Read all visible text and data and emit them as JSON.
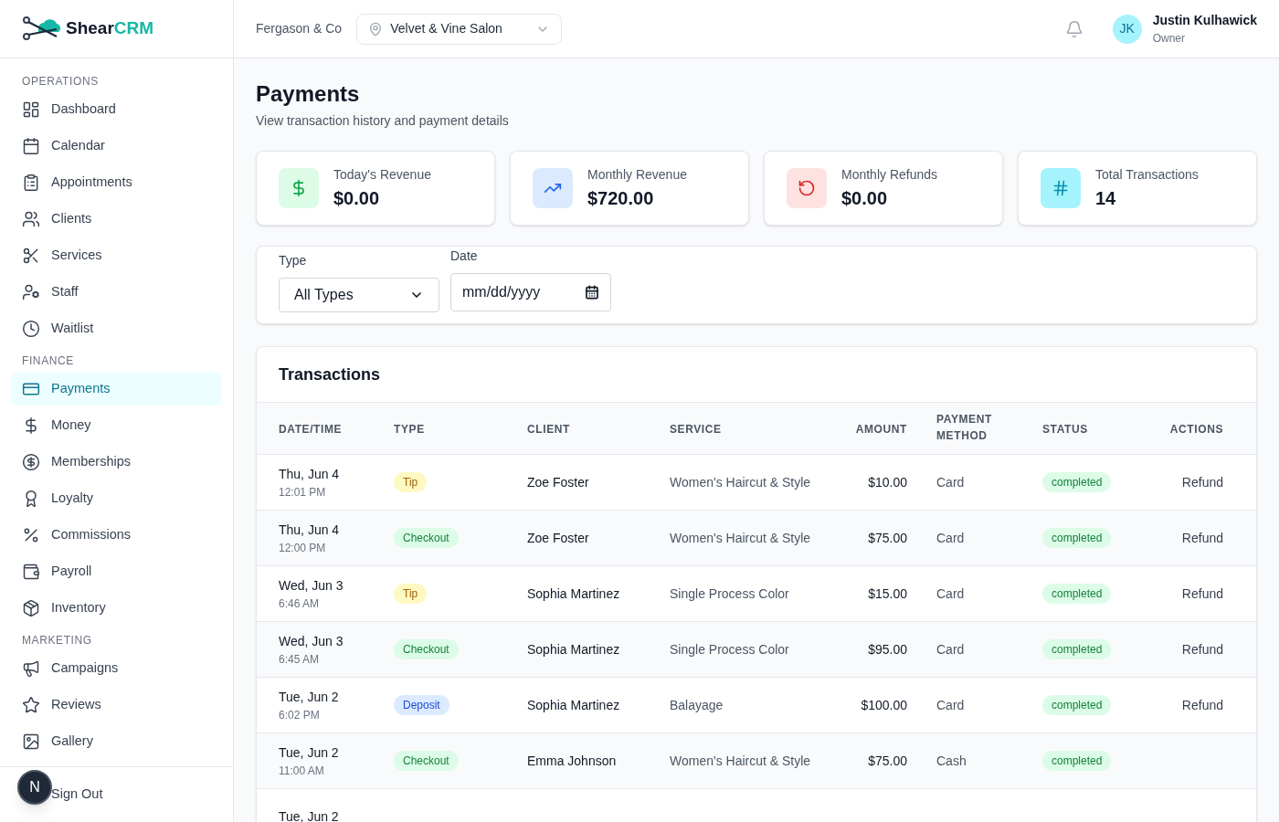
{
  "brand": {
    "first": "Shear",
    "second": "CRM"
  },
  "sidebar": {
    "sections": [
      {
        "label": "OPERATIONS",
        "items": [
          {
            "label": "Dashboard",
            "selected": false
          },
          {
            "label": "Calendar",
            "selected": false
          },
          {
            "label": "Appointments",
            "selected": false
          },
          {
            "label": "Clients",
            "selected": false
          },
          {
            "label": "Services",
            "selected": false
          },
          {
            "label": "Staff",
            "selected": false
          },
          {
            "label": "Waitlist",
            "selected": false
          }
        ]
      },
      {
        "label": "FINANCE",
        "items": [
          {
            "label": "Payments",
            "selected": true
          },
          {
            "label": "Money",
            "selected": false
          },
          {
            "label": "Memberships",
            "selected": false
          },
          {
            "label": "Loyalty",
            "selected": false
          },
          {
            "label": "Commissions",
            "selected": false
          },
          {
            "label": "Payroll",
            "selected": false
          },
          {
            "label": "Inventory",
            "selected": false
          }
        ]
      },
      {
        "label": "MARKETING",
        "items": [
          {
            "label": "Campaigns",
            "selected": false
          },
          {
            "label": "Reviews",
            "selected": false
          },
          {
            "label": "Gallery",
            "selected": false
          }
        ]
      }
    ],
    "sign_out": "Sign Out"
  },
  "dev_badge": "N",
  "header": {
    "company": "Fergason & Co",
    "location": "Velvet & Vine Salon",
    "user": {
      "initials": "JK",
      "name": "Justin Kulhawick",
      "role": "Owner"
    }
  },
  "page": {
    "title": "Payments",
    "subtitle": "View transaction history and payment details"
  },
  "stats": [
    {
      "label": "Today's Revenue",
      "value": "$0.00"
    },
    {
      "label": "Monthly Revenue",
      "value": "$720.00"
    },
    {
      "label": "Monthly Refunds",
      "value": "$0.00"
    },
    {
      "label": "Total Transactions",
      "value": "14"
    }
  ],
  "filters": {
    "type": {
      "label": "Type",
      "value": "All Types"
    },
    "date": {
      "label": "Date",
      "placeholder": "mm/dd/yyyy"
    }
  },
  "transactions": {
    "title": "Transactions",
    "columns": [
      "DATE/TIME",
      "TYPE",
      "CLIENT",
      "SERVICE",
      "AMOUNT",
      "PAYMENT METHOD",
      "STATUS",
      "ACTIONS"
    ],
    "rows": [
      {
        "date": "Thu, Jun 4",
        "time": "12:01 PM",
        "type": {
          "label": "Tip",
          "color": "#fef9c3"
        },
        "client": "Zoe Foster",
        "service": "Women's Haircut & Style",
        "amount": "$10.00",
        "method": "Card",
        "status": "completed",
        "action": "Refund"
      },
      {
        "date": "Thu, Jun 4",
        "time": "12:00 PM",
        "type": {
          "label": "Checkout",
          "color": "#dcfce7"
        },
        "client": "Zoe Foster",
        "service": "Women's Haircut & Style",
        "amount": "$75.00",
        "method": "Card",
        "status": "completed",
        "action": "Refund"
      },
      {
        "date": "Wed, Jun 3",
        "time": "6:46 AM",
        "type": {
          "label": "Tip",
          "color": "#fef9c3"
        },
        "client": "Sophia Martinez",
        "service": "Single Process Color",
        "amount": "$15.00",
        "method": "Card",
        "status": "completed",
        "action": "Refund"
      },
      {
        "date": "Wed, Jun 3",
        "time": "6:45 AM",
        "type": {
          "label": "Checkout",
          "color": "#dcfce7"
        },
        "client": "Sophia Martinez",
        "service": "Single Process Color",
        "amount": "$95.00",
        "method": "Card",
        "status": "completed",
        "action": "Refund"
      },
      {
        "date": "Tue, Jun 2",
        "time": "6:02 PM",
        "type": {
          "label": "Deposit",
          "color": "#dbeafe"
        },
        "client": "Sophia Martinez",
        "service": "Balayage",
        "amount": "$100.00",
        "method": "Card",
        "status": "completed",
        "action": "Refund"
      },
      {
        "date": "Tue, Jun 2",
        "time": "11:00 AM",
        "type": {
          "label": "Checkout",
          "color": "#dcfce7"
        },
        "client": "Emma Johnson",
        "service": "Women's Haircut & Style",
        "amount": "$75.00",
        "method": "Cash",
        "status": "completed"
      },
      {
        "date": "Tue, Jun 2"
      }
    ]
  }
}
